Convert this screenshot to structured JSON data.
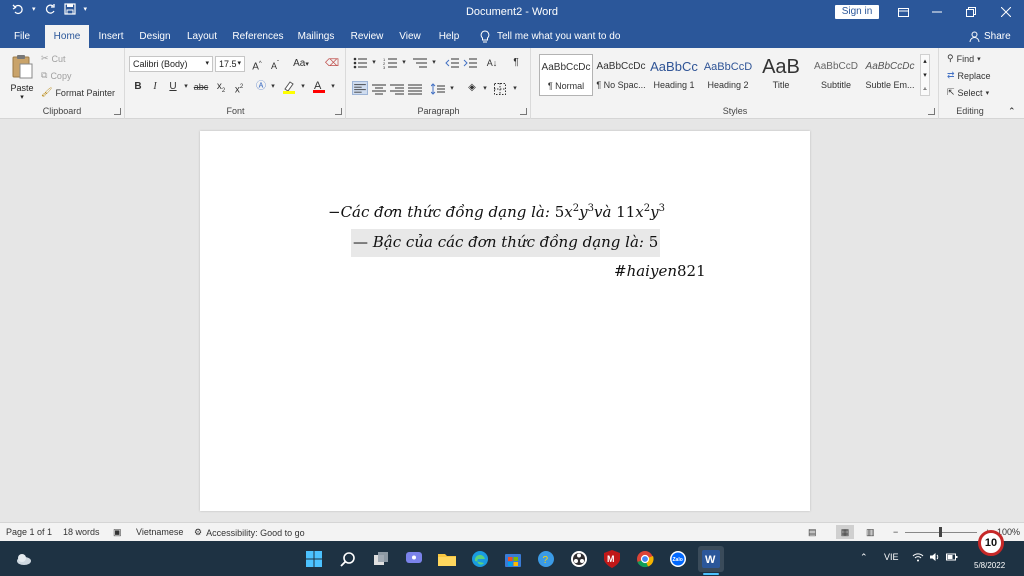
{
  "window": {
    "title": "Document2 - Word",
    "signin_label": "Sign in"
  },
  "tabs": [
    {
      "label": "File"
    },
    {
      "label": "Home"
    },
    {
      "label": "Insert"
    },
    {
      "label": "Design"
    },
    {
      "label": "Layout"
    },
    {
      "label": "References"
    },
    {
      "label": "Mailings"
    },
    {
      "label": "Review"
    },
    {
      "label": "View"
    },
    {
      "label": "Help"
    }
  ],
  "tellme": "Tell me what you want to do",
  "share_label": "Share",
  "clipboard": {
    "paste": "Paste",
    "cut": "Cut",
    "copy": "Copy",
    "format_painter": "Format Painter",
    "label": "Clipboard"
  },
  "font": {
    "name": "Calibri (Body)",
    "size": "17.5",
    "label": "Font",
    "case_label": "Aa"
  },
  "paragraph": {
    "label": "Paragraph"
  },
  "styles": {
    "label": "Styles",
    "items": [
      {
        "sample": "AaBbCcDc",
        "name": "¶ Normal"
      },
      {
        "sample": "AaBbCcDc",
        "name": "¶ No Spac..."
      },
      {
        "sample": "AaBbCc",
        "name": "Heading 1"
      },
      {
        "sample": "AaBbCcD",
        "name": "Heading 2"
      },
      {
        "sample": "AaB",
        "name": "Title"
      },
      {
        "sample": "AaBbCcD",
        "name": "Subtitle"
      },
      {
        "sample": "AaBbCcDc",
        "name": "Subtle Em..."
      }
    ]
  },
  "editing": {
    "find": "Find",
    "replace": "Replace",
    "select": "Select",
    "label": "Editing"
  },
  "document": {
    "line1_dash": "−",
    "line1_text": "Các đơn thức đồng dạng là:",
    "line1_term1_coef": "5",
    "line1_term1_var1": "x",
    "line1_term1_exp1": "2",
    "line1_term1_var2": "y",
    "line1_term1_exp2": "3",
    "line1_conj": "và",
    "line1_term2_coef": "11",
    "line1_term2_var1": "x",
    "line1_term2_exp1": "2",
    "line1_term2_var2": "y",
    "line1_term2_exp2": "3",
    "line2_dash": "—",
    "line2_text": "Bậc của các đơn thức đồng dạng là:",
    "line2_value": "5",
    "line3_hash": "#",
    "line3_name": "haiyen",
    "line3_num": "821"
  },
  "status": {
    "page": "Page 1 of 1",
    "words": "18 words",
    "language": "Vietnamese",
    "accessibility": "Accessibility: Good to go",
    "zoom": "100%"
  },
  "taskbar": {
    "lang": "VIE",
    "date": "5/8/2022",
    "notifications": "10"
  },
  "colors": {
    "accent": "#2b579a",
    "taskbar": "#1e3243"
  }
}
